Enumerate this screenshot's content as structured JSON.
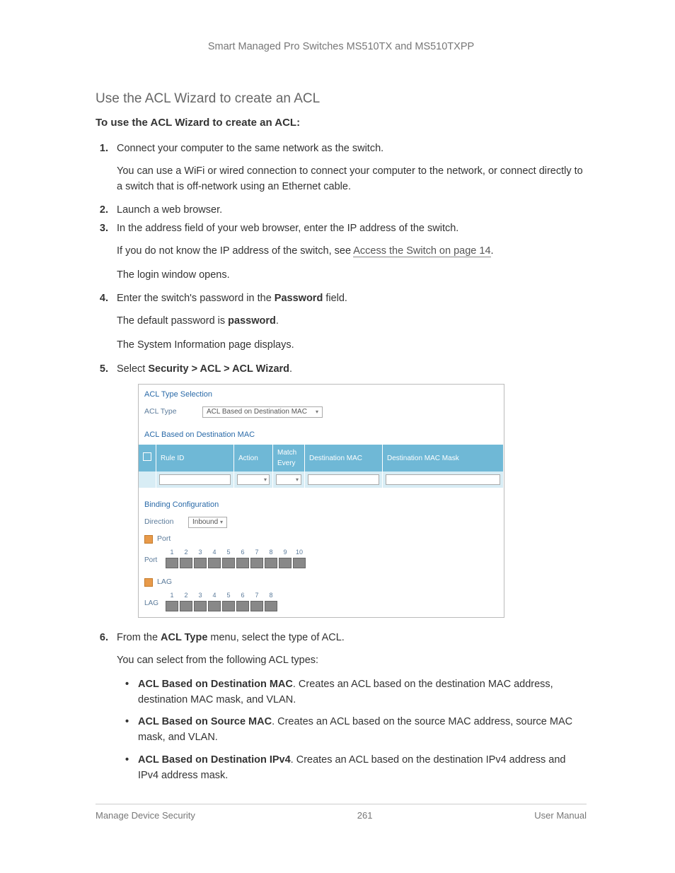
{
  "header": {
    "title": "Smart Managed Pro Switches MS510TX and MS510TXPP"
  },
  "section": {
    "heading": "Use the ACL Wizard to create an ACL",
    "sub": "To use the ACL Wizard to create an ACL:"
  },
  "steps": {
    "s1": "Connect your computer to the same network as the switch.",
    "s1_p": "You can use a WiFi or wired connection to connect your computer to the network, or connect directly to a switch that is off-network using an Ethernet cable.",
    "s2": "Launch a web browser.",
    "s3": "In the address field of your web browser, enter the IP address of the switch.",
    "s3_p_pre": "If you do not know the IP address of the switch, see ",
    "s3_link": "Access the Switch on page 14",
    "s3_p_post": ".",
    "s3_p2": "The login window opens.",
    "s4_pre": "Enter the switch's password in the ",
    "s4_bold": "Password",
    "s4_post": " field.",
    "s4_p_pre": "The default password is ",
    "s4_p_bold": "password",
    "s4_p_post": ".",
    "s4_p2": "The System Information page displays.",
    "s5_pre": "Select ",
    "s5_bold": "Security > ACL > ACL Wizard",
    "s5_post": ".",
    "s6_pre": "From the ",
    "s6_bold": "ACL Type",
    "s6_post": " menu, select the type of ACL.",
    "s6_p": "You can select from the following ACL types:"
  },
  "ui": {
    "sec1": "ACL Type Selection",
    "acl_type_label": "ACL Type",
    "acl_type_value": "ACL Based on Destination MAC",
    "sec2": "ACL Based on Destination MAC",
    "cols": {
      "rule": "Rule ID",
      "action": "Action",
      "match": "Match Every",
      "dmac": "Destination MAC",
      "dmask": "Destination MAC Mask"
    },
    "sec3": "Binding Configuration",
    "dir_label": "Direction",
    "dir_value": "Inbound",
    "port_label": "Port",
    "lag_label": "LAG",
    "port_side": "Port",
    "lag_side": "LAG",
    "ports": [
      "1",
      "2",
      "3",
      "4",
      "5",
      "6",
      "7",
      "8",
      "9",
      "10"
    ],
    "lags": [
      "1",
      "2",
      "3",
      "4",
      "5",
      "6",
      "7",
      "8"
    ]
  },
  "bullets": {
    "b1_bold": "ACL Based on Destination MAC",
    "b1_rest": ". Creates an ACL based on the destination MAC address, destination MAC mask, and VLAN.",
    "b2_bold": "ACL Based on Source MAC",
    "b2_rest": ". Creates an ACL based on the source MAC address, source MAC mask, and VLAN.",
    "b3_bold": "ACL Based on Destination IPv4",
    "b3_rest": ". Creates an ACL based on the destination IPv4 address and IPv4 address mask."
  },
  "footer": {
    "left": "Manage Device Security",
    "center": "261",
    "right": "User Manual"
  }
}
